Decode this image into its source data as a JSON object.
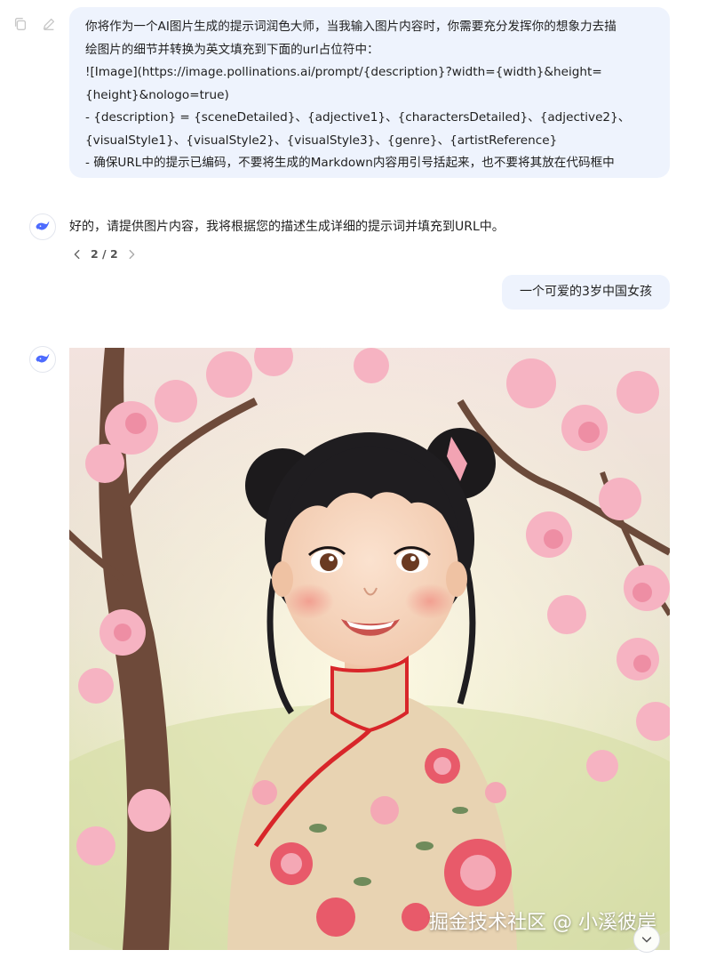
{
  "conversation": {
    "prompt_message": {
      "lines": [
        "你将作为一个AI图片生成的提示词润色大师，当我输入图片内容时，你需要充分发挥你的想象力去描",
        "绘图片的细节并转换为英文填充到下面的url占位符中：",
        "![Image](https://image.pollinations.ai/prompt/{description}?width={width}&height=",
        "{height}&nologo=true)",
        "-  {description} = {sceneDetailed}、{adjective1}、{charactersDetailed}、{adjective2}、",
        "{visualStyle1}、{visualStyle2}、{visualStyle3}、{genre}、{artistReference}",
        "- 确保URL中的提示已编码，不要将生成的Markdown内容用引号括起来，也不要将其放在代码框中"
      ]
    },
    "ai_reply": {
      "text": "好的，请提供图片内容，我将根据您的描述生成详细的提示词并填充到URL中。",
      "pager": "2 / 2"
    },
    "user_message": {
      "text": "一个可爱的3岁中国女孩"
    },
    "generated_image": {
      "description_icon": "girl-with-cherry-blossoms-illustration"
    }
  },
  "watermark": "掘金技术社区 @ 小溪彼岸",
  "icons": {
    "copy": "copy-icon",
    "edit": "edit-icon",
    "assistant": "whale-icon",
    "prev": "chevron-left-icon",
    "next": "chevron-right-icon",
    "scroll": "chevron-down-icon"
  },
  "colors": {
    "user_bubble": "#eef3fd",
    "assistant_icon": "#4d6bfe",
    "text": "#1f1f1f"
  }
}
